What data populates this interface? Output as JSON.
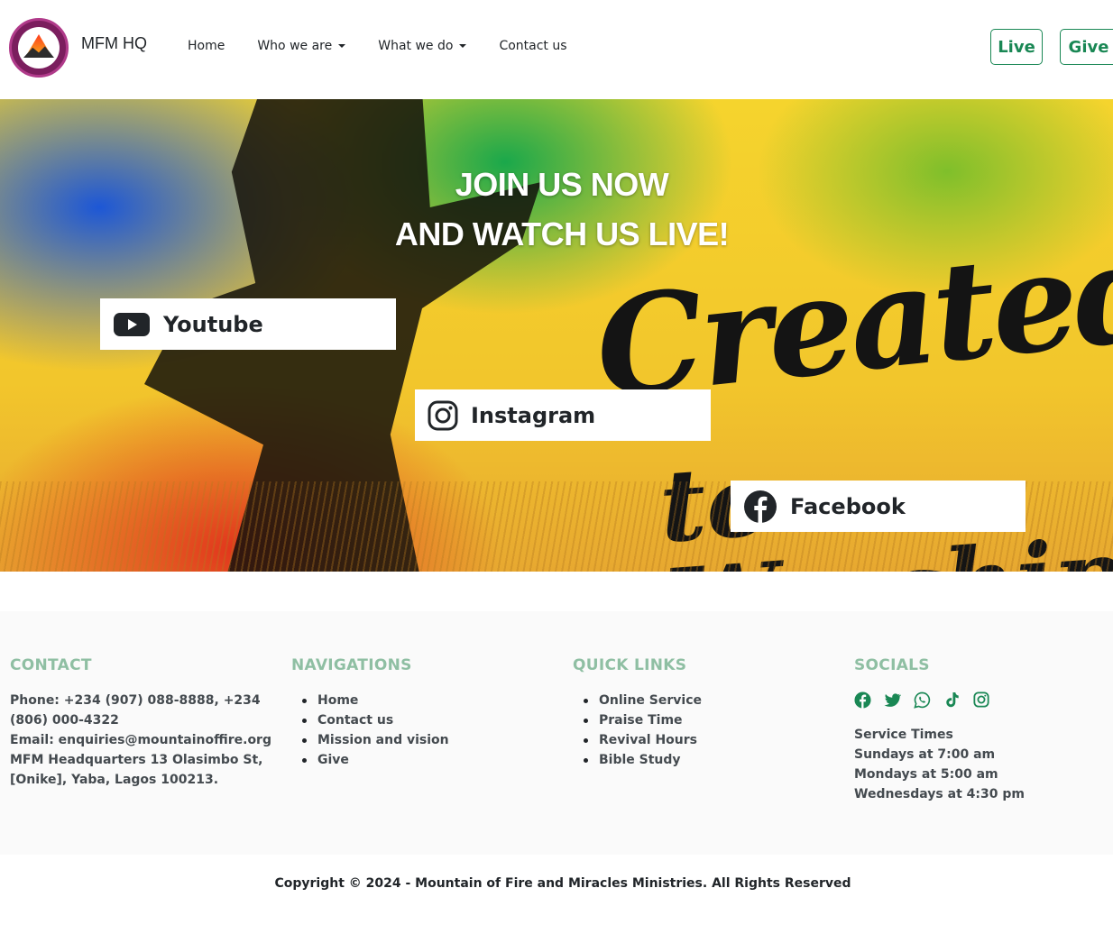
{
  "header": {
    "brand": "MFM HQ",
    "nav": [
      {
        "label": "Home"
      },
      {
        "label": "Who we are"
      },
      {
        "label": "What we do"
      },
      {
        "label": "Contact us"
      }
    ],
    "live_label": "Live",
    "give_label": "Give",
    "accent_color": "#198754"
  },
  "hero": {
    "line1": "JOIN US NOW",
    "line2": "AND WATCH US LIVE!",
    "script_line1": "Created",
    "script_line2": "to Worship",
    "buttons": [
      {
        "label": "Youtube",
        "icon": "youtube-icon"
      },
      {
        "label": "Instagram",
        "icon": "instagram-icon"
      },
      {
        "label": "Facebook",
        "icon": "facebook-icon"
      }
    ]
  },
  "footer": {
    "contact": {
      "heading": "CONTACT",
      "phone": "Phone: +234 (907) 088-8888, +234 (806) 000-4322",
      "email": "Email: enquiries@mountainoffire.org",
      "address": "MFM Headquarters 13 Olasimbo St, [Onike], Yaba, Lagos 100213."
    },
    "navigations": {
      "heading": "NAVIGATIONS",
      "items": [
        "Home",
        "Contact us",
        "Mission and vision",
        "Give"
      ]
    },
    "quick_links": {
      "heading": "QUICK LINKS",
      "items": [
        "Online Service",
        "Praise Time",
        "Revival Hours",
        "Bible Study"
      ]
    },
    "socials": {
      "heading": "SOCIALS",
      "icons": [
        "facebook-icon",
        "twitter-icon",
        "whatsapp-icon",
        "tiktok-icon",
        "instagram-icon"
      ],
      "service_title": "Service Times",
      "times": [
        "Sundays at 7:00 am",
        "Mondays at 5:00 am",
        "Wednesdays at 4:30 pm"
      ]
    },
    "heading_color": "#8fbfa3",
    "copyright": "Copyright © 2024 - Mountain of Fire and Miracles Ministries. All Rights Reserved"
  }
}
